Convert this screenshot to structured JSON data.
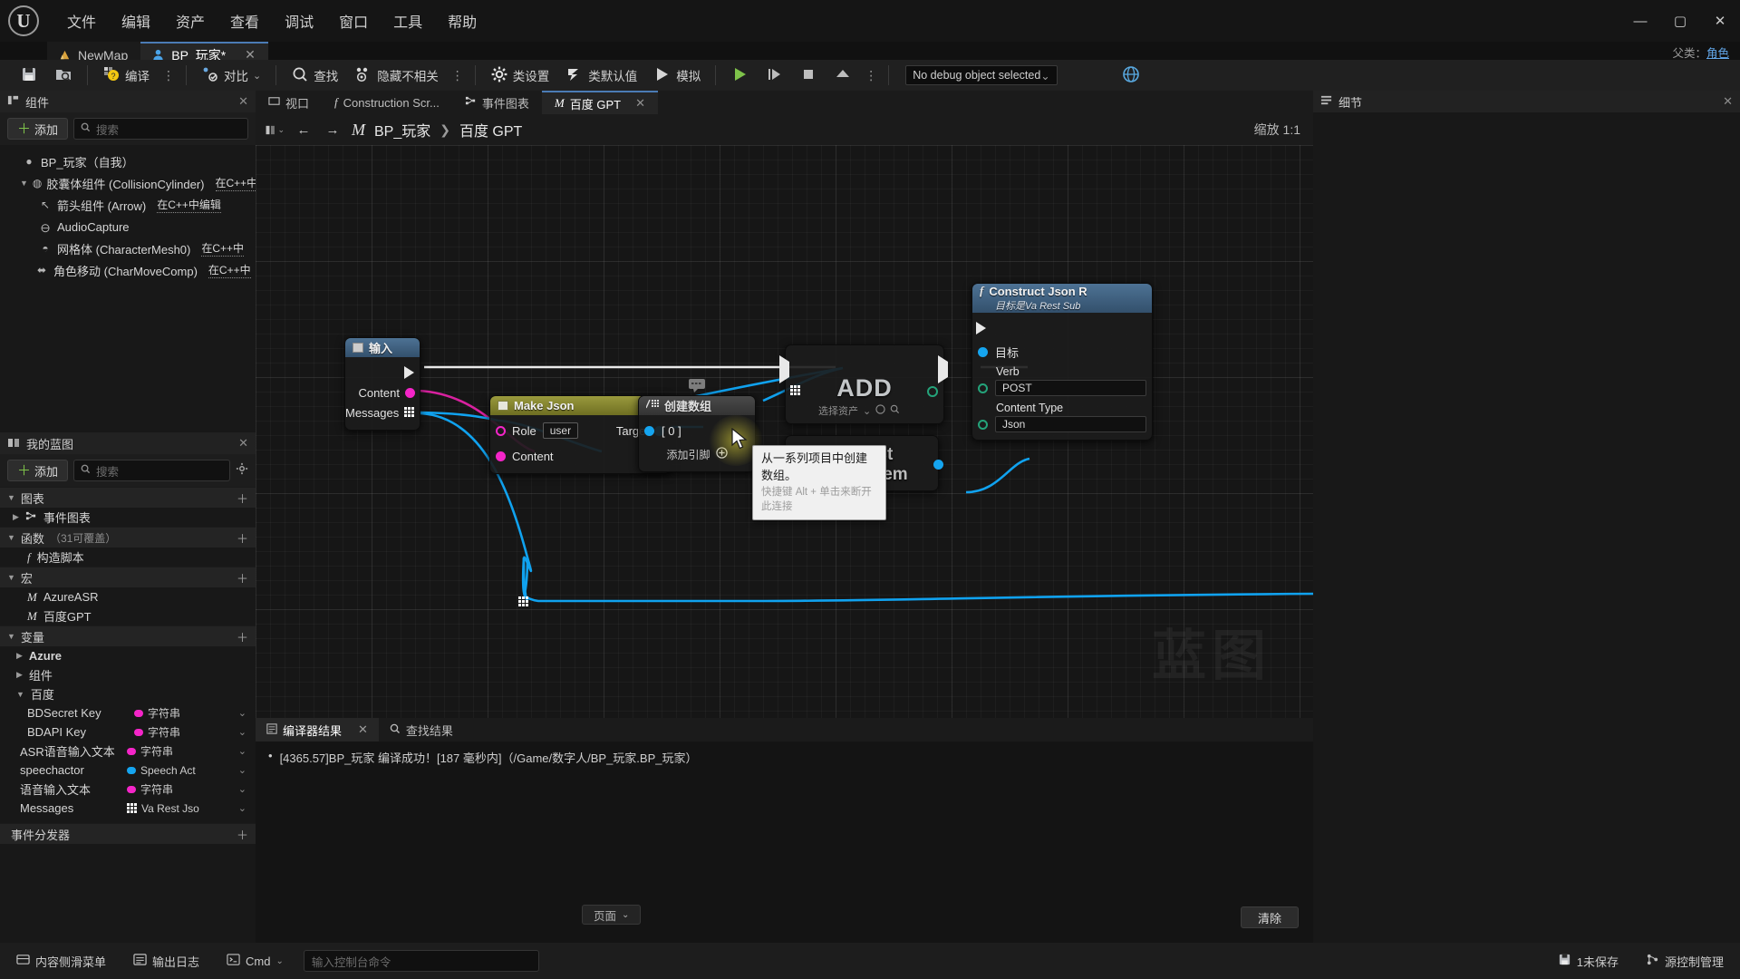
{
  "window": {
    "minimize": "—",
    "maximize": "▢",
    "close": "✕",
    "parent_class_label": "父类：",
    "parent_class_value": "角色"
  },
  "menu": {
    "items": [
      {
        "label": "文件"
      },
      {
        "label": "编辑"
      },
      {
        "label": "资产"
      },
      {
        "label": "查看"
      },
      {
        "label": "调试"
      },
      {
        "label": "窗口"
      },
      {
        "label": "工具"
      },
      {
        "label": "帮助"
      }
    ]
  },
  "doc_tabs": [
    {
      "label": "NewMap",
      "icon": "map-icon",
      "active": false
    },
    {
      "label": "BP_玩家*",
      "icon": "blueprint-icon",
      "active": true,
      "close": "✕"
    }
  ],
  "toolbar": {
    "save_label": "",
    "browse_label": "",
    "compile_label": "编译",
    "diff_label": "对比",
    "find_label": "查找",
    "hide_unrelated_label": "隐藏不相关",
    "class_settings_label": "类设置",
    "class_defaults_label": "类默认值",
    "simulate_label": "模拟",
    "dots": "⋮",
    "debug_object": "No debug object selected",
    "chevron": "⌄"
  },
  "components_panel": {
    "title": "组件",
    "close": "✕",
    "add_label": "添加",
    "search_placeholder": "搜索",
    "tree": [
      {
        "label": "BP_玩家（自我）",
        "icon": "actor-icon",
        "indent": 0,
        "caret": "",
        "cpp": ""
      },
      {
        "label": "胶囊体组件 (CollisionCylinder)",
        "icon": "capsule-icon",
        "indent": 1,
        "caret": "▼",
        "cpp": "在C++中"
      },
      {
        "label": "箭头组件 (Arrow)",
        "icon": "arrow-icon",
        "indent": 2,
        "caret": "",
        "cpp": "在C++中编辑"
      },
      {
        "label": "AudioCapture",
        "icon": "audio-icon",
        "indent": 2,
        "caret": "",
        "cpp": ""
      },
      {
        "label": "网格体 (CharacterMesh0)",
        "icon": "mesh-icon",
        "indent": 2,
        "caret": "",
        "cpp": "在C++中"
      },
      {
        "label": "角色移动 (CharMoveComp)",
        "icon": "move-icon",
        "indent": 1,
        "caret": "",
        "cpp": "在C++中"
      }
    ]
  },
  "myblueprint_panel": {
    "title": "我的蓝图",
    "close": "✕",
    "add_label": "添加",
    "search_placeholder": "搜索",
    "settings_icon": "gear-icon",
    "sections": [
      {
        "name": "图表",
        "caret": "▼",
        "plus": "＋",
        "items": [
          {
            "label": "事件图表",
            "icon": "eventgraph-icon",
            "caret": "▶"
          }
        ]
      },
      {
        "name": "函数",
        "count": "（31可覆盖）",
        "caret": "▼",
        "plus": "＋",
        "items": [
          {
            "label": "构造脚本",
            "icon": "function-icon",
            "caret": ""
          }
        ]
      },
      {
        "name": "宏",
        "caret": "▼",
        "plus": "＋",
        "items": [
          {
            "label": "AzureASR",
            "icon": "macro-icon",
            "caret": ""
          },
          {
            "label": "百度GPT",
            "icon": "macro-icon",
            "caret": ""
          }
        ]
      },
      {
        "name": "变量",
        "caret": "▼",
        "plus": "＋",
        "items": []
      }
    ],
    "var_groups": [
      {
        "label": "Azure",
        "caret": "▶",
        "bold": true
      },
      {
        "label": "组件",
        "caret": "▶",
        "bold": false
      },
      {
        "label": "百度",
        "caret": "▼",
        "bold": false
      }
    ],
    "variables": [
      {
        "name": "BDSecret Key",
        "type": "字符串",
        "color": "#f425c8",
        "shape": "dot",
        "eye": "⌄"
      },
      {
        "name": "BDAPI Key",
        "type": "字符串",
        "color": "#f425c8",
        "shape": "dot",
        "eye": "⌄"
      },
      {
        "name": "ASR语音输入文本",
        "type": "字符串",
        "color": "#f425c8",
        "shape": "dot",
        "eye": "⌄"
      },
      {
        "name": "speechactor",
        "type": "Speech Act",
        "color": "#15a5f0",
        "shape": "dot",
        "eye": "⌄"
      },
      {
        "name": "语音输入文本",
        "type": "字符串",
        "color": "#f425c8",
        "shape": "dot",
        "eye": "⌄"
      },
      {
        "name": "Messages",
        "type": "Va Rest Jso",
        "color": "#15a5f0",
        "shape": "grid",
        "eye": "⌄"
      }
    ],
    "footer_section": {
      "name": "事件分发器",
      "plus": "＋"
    }
  },
  "graph": {
    "tabs": [
      {
        "label": "视口",
        "icon": "viewport-icon",
        "active": false
      },
      {
        "label": "Construction Scr...",
        "icon": "construction-icon",
        "active": false
      },
      {
        "label": "事件图表",
        "icon": "eventgraph-icon",
        "active": false
      },
      {
        "label": "百度 GPT",
        "icon": "macro-icon",
        "active": true,
        "close": "✕"
      }
    ],
    "breadcrumb": {
      "layout_icon": "layout-icon",
      "back": "←",
      "forward": "→",
      "macro_icon": "M",
      "root": "BP_玩家",
      "sep": "❯",
      "current": "百度 GPT"
    },
    "zoom_label": "缩放 1:1",
    "watermark": "蓝图",
    "nodes": [
      {
        "id": "input",
        "title": "输入",
        "header_style": "blue",
        "pins_out_exec": true,
        "pins": [
          {
            "label": "Content",
            "color": "#f425c8",
            "shape": "dot",
            "side": "out"
          },
          {
            "label": "Messages",
            "color": "#15a5f0",
            "shape": "grid",
            "side": "out"
          }
        ]
      },
      {
        "id": "makejson",
        "title": "Make Json",
        "header_style": "olive",
        "pins": [
          {
            "label": "Role",
            "color": "#f425c8",
            "shape": "ring",
            "side": "in",
            "value": "user"
          },
          {
            "label": "Content",
            "color": "#f425c8",
            "shape": "dot",
            "side": "in"
          },
          {
            "label": "Target",
            "color": "#15a5f0",
            "shape": "dot",
            "side": "out"
          }
        ]
      },
      {
        "id": "makearray",
        "title": "创建数组",
        "header_style": "grey",
        "pins": [
          {
            "label": "[ 0 ]",
            "color": "#15a5f0",
            "shape": "dot",
            "side": "in"
          }
        ],
        "add_pin_label": "添加引脚"
      },
      {
        "id": "add",
        "title": "ADD",
        "header_style": "none",
        "asset_label": "选择资产"
      },
      {
        "id": "varest",
        "title": "Va Rest Subsystem",
        "header_style": "none"
      },
      {
        "id": "constructjson",
        "title": "Construct Json R",
        "subtitle": "目标是Va Rest Sub",
        "header_style": "blue",
        "pins": [
          {
            "label": "目标",
            "color": "#15a5f0",
            "shape": "dot",
            "side": "in"
          },
          {
            "label": "Verb",
            "color": "#24a37a",
            "shape": "ring",
            "side": "in",
            "value": "POST"
          },
          {
            "label": "Content Type",
            "color": "#24a37a",
            "shape": "ring",
            "side": "in",
            "value": "Json"
          }
        ]
      }
    ],
    "tooltip": {
      "text": "从一系列项目中创建数组。",
      "sub": "快捷键 Alt + 单击来断开此连接"
    }
  },
  "details_panel": {
    "title": "细节",
    "close": "✕"
  },
  "results_panel": {
    "tabs": [
      {
        "label": "编译器结果",
        "icon": "compiler-icon",
        "active": true,
        "close": "✕"
      },
      {
        "label": "查找结果",
        "icon": "search-icon",
        "active": false
      }
    ],
    "log_lines": [
      {
        "bullet": "•",
        "text": "[4365.57]BP_玩家 编译成功！[187 毫秒内]（/Game/数字人/BP_玩家.BP_玩家）"
      }
    ],
    "page_button": "页面",
    "clear_button": "清除"
  },
  "statusbar": {
    "content_drawer": "内容侧滑菜单",
    "output_log": "输出日志",
    "cmd_label": "Cmd",
    "cmd_placeholder": "输入控制台命令",
    "unsaved": "1未保存",
    "source_control": "源控制管理"
  }
}
